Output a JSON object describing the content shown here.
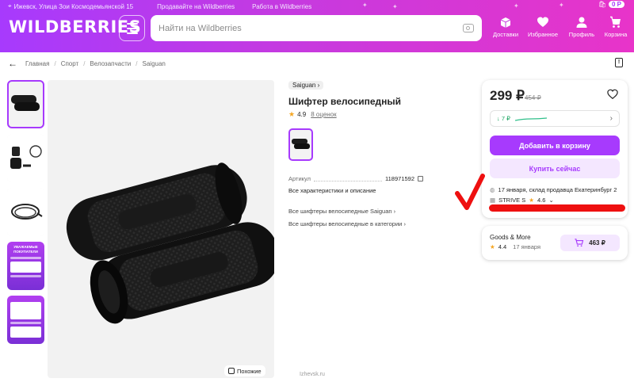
{
  "colors": {
    "accent": "#a73afd",
    "accent_light": "#f4e7ff",
    "trend_green": "#17a35f",
    "star": "#f5a623",
    "marker_red": "#ee1010"
  },
  "topbar": {
    "address": "Ижевск, Улица Зои Космодемьянской 15",
    "sell": "Продавайте на Wildberries",
    "work": "Работа в Wildberries",
    "cart_sum": "0 Р"
  },
  "header": {
    "logo": "WILDBERRIES",
    "search_placeholder": "Найти на Wildberries",
    "nav": [
      {
        "label": "Доставки",
        "icon": "delivery-box-icon"
      },
      {
        "label": "Избранное",
        "icon": "heart-icon"
      },
      {
        "label": "Профиль",
        "icon": "user-icon"
      },
      {
        "label": "Корзина",
        "icon": "cart-icon"
      }
    ]
  },
  "breadcrumbs": [
    "Главная",
    "Спорт",
    "Велозапчасти",
    "Saiguan"
  ],
  "gallery": {
    "promo_text": "УВАЖАЕМЫЕ ПОКУПАТЕЛИ",
    "similar_label": "Похожие"
  },
  "product": {
    "brand": "Saiguan",
    "title": "Шифтер велосипедный",
    "rating": "4.9",
    "reviews": "8 оценок",
    "article_label": "Артикул",
    "article_value": "118971592",
    "all_chars": "Все характеристики и описание",
    "link_brand": "Все шифтеры велосипедные Saiguan",
    "link_category": "Все шифтеры велосипедные в категории"
  },
  "buy": {
    "price": "299 ₽",
    "old_price": "454 ₽",
    "trend": "↓ 7 ₽",
    "add_to_cart": "Добавить в корзину",
    "buy_now": "Купить сейчас",
    "delivery": "17 января, склад продавца Екатеринбург 2",
    "seller_name": "STRIVE S",
    "seller_rating": "4.6"
  },
  "alt_offer": {
    "seller": "Goods & More",
    "rating": "4.4",
    "date": "17 января",
    "price": "463 ₽"
  },
  "watermark": "Izhevsk.ru"
}
